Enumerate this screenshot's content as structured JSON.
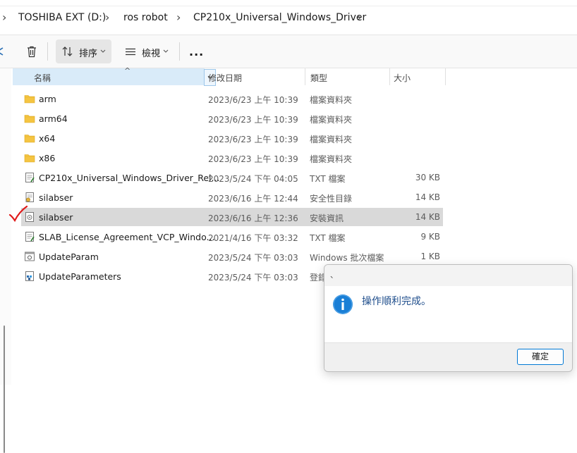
{
  "breadcrumb": {
    "items": [
      "TOSHIBA EXT (D:)",
      "ros robot",
      "CP210x_Universal_Windows_Driver"
    ]
  },
  "toolbar": {
    "sort_label": "排序",
    "view_label": "檢視",
    "more_label": "..."
  },
  "columns": {
    "name": "名稱",
    "date": "修改日期",
    "type": "類型",
    "size": "大小"
  },
  "files": [
    {
      "name": "arm",
      "date": "2023/6/23 上午 10:39",
      "type": "檔案資料夾",
      "size": "",
      "icon": "folder-icon"
    },
    {
      "name": "arm64",
      "date": "2023/6/23 上午 10:39",
      "type": "檔案資料夾",
      "size": "",
      "icon": "folder-icon"
    },
    {
      "name": "x64",
      "date": "2023/6/23 上午 10:39",
      "type": "檔案資料夾",
      "size": "",
      "icon": "folder-icon"
    },
    {
      "name": "x86",
      "date": "2023/6/23 上午 10:39",
      "type": "檔案資料夾",
      "size": "",
      "icon": "folder-icon"
    },
    {
      "name": "CP210x_Universal_Windows_Driver_Rel...",
      "date": "2023/5/24 下午 04:05",
      "type": "TXT 檔案",
      "size": "30 KB",
      "icon": "text-file-icon"
    },
    {
      "name": "silabser",
      "date": "2023/6/16 上午 12:44",
      "type": "安全性目錄",
      "size": "14 KB",
      "icon": "security-catalog-icon"
    },
    {
      "name": "silabser",
      "date": "2023/6/16 上午 12:36",
      "type": "安裝資訊",
      "size": "14 KB",
      "icon": "setup-info-icon"
    },
    {
      "name": "SLAB_License_Agreement_VCP_Windo...",
      "date": "2021/4/16 下午 03:32",
      "type": "TXT 檔案",
      "size": "9 KB",
      "icon": "text-file-icon"
    },
    {
      "name": "UpdateParam",
      "date": "2023/5/24 下午 03:03",
      "type": "Windows 批次檔案",
      "size": "1 KB",
      "icon": "batch-file-icon"
    },
    {
      "name": "UpdateParameters",
      "date": "2023/5/24 下午 03:03",
      "type": "登錄",
      "size": "",
      "icon": "registry-file-icon"
    }
  ],
  "selected_index": 6,
  "dialog": {
    "title": "、",
    "message": "操作順利完成。",
    "ok_label": "確定",
    "icon": "info-icon"
  },
  "colors": {
    "accent": "#0078d4",
    "selection": "#d9d9d9",
    "header_highlight": "#d9ebf9",
    "folder": "#f5c542",
    "annotation": "#e01a1a"
  }
}
